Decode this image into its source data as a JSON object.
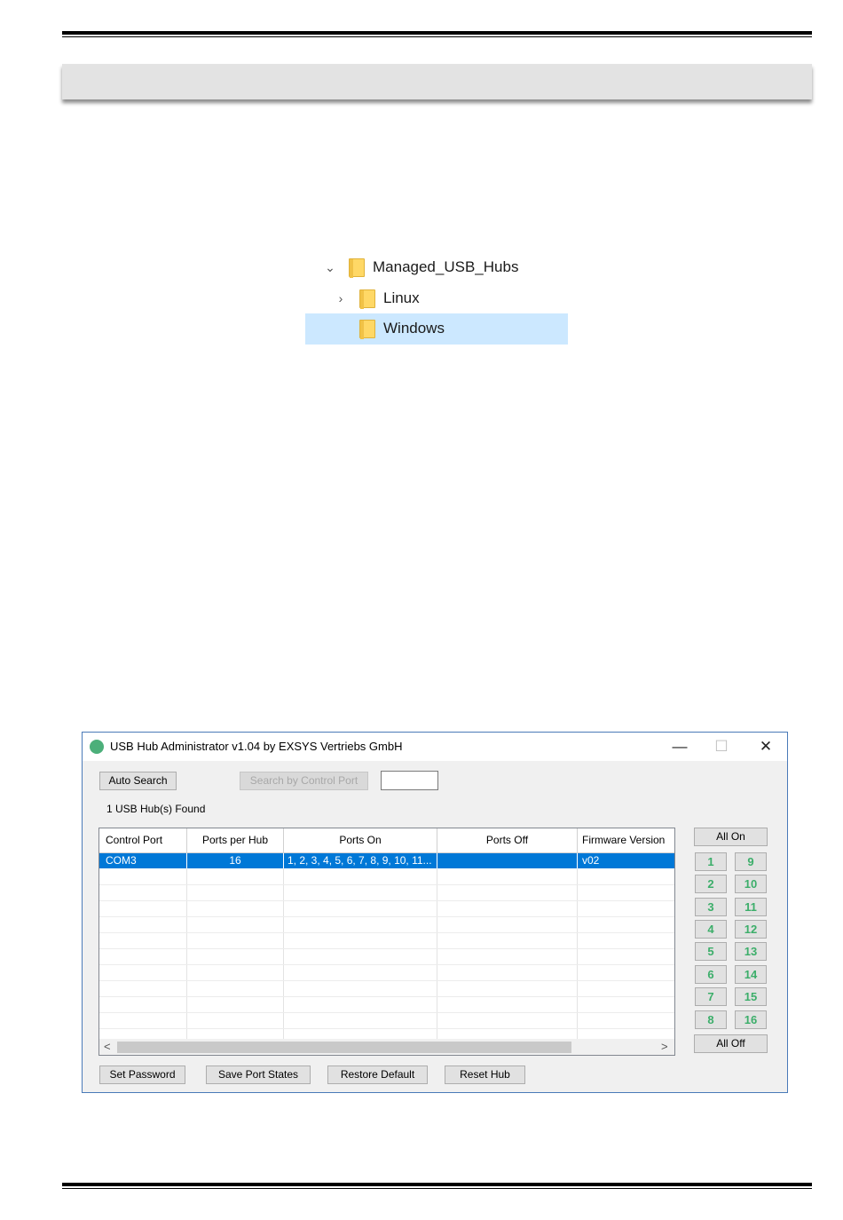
{
  "tree": {
    "root": "Managed_USB_Hubs",
    "children": [
      "Linux",
      "Windows"
    ],
    "selected": "Windows"
  },
  "window": {
    "title": "USB Hub Administrator v1.04 by EXSYS Vertriebs GmbH",
    "controls": {
      "minimize": "—",
      "maximize": "☐",
      "close": "✕"
    },
    "buttons": {
      "auto_search": "Auto Search",
      "search_by_port": "Search by Control Port",
      "set_password": "Set Password",
      "save_port_states": "Save Port States",
      "restore_default": "Restore Default",
      "reset_hub": "Reset Hub",
      "all_on": "All On",
      "all_off": "All Off"
    },
    "status": "1 USB Hub(s) Found",
    "table": {
      "columns": [
        "Control Port",
        "Ports per Hub",
        "Ports On",
        "Ports Off",
        "Firmware Version"
      ],
      "rows": [
        [
          "COM3",
          "16",
          "1, 2, 3, 4, 5, 6, 7, 8, 9, 10, 11...",
          "",
          "v02"
        ]
      ]
    },
    "ports_left": [
      "1",
      "2",
      "3",
      "4",
      "5",
      "6",
      "7",
      "8"
    ],
    "ports_right": [
      "9",
      "10",
      "11",
      "12",
      "13",
      "14",
      "15",
      "16"
    ],
    "scroll": {
      "left": "<",
      "right": ">"
    }
  }
}
